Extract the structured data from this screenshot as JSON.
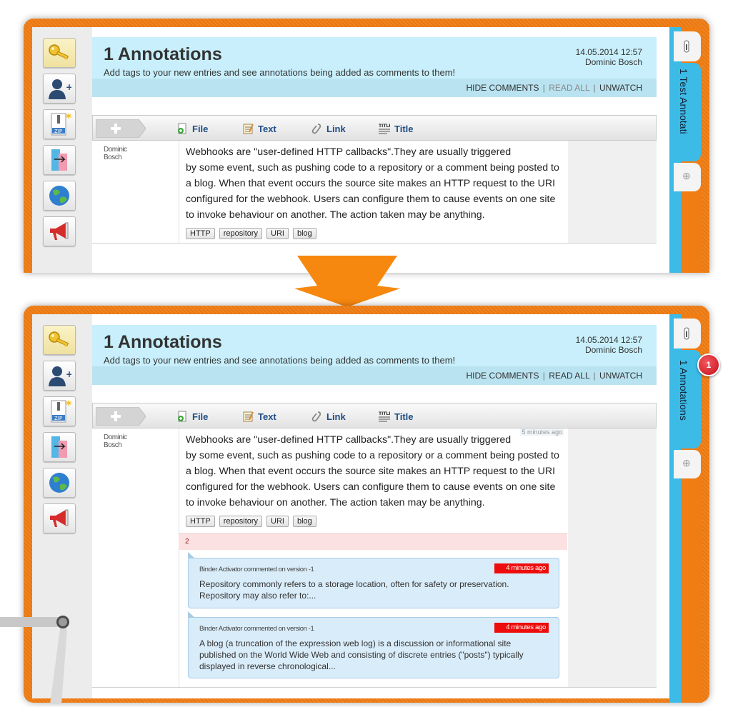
{
  "sidebar_tools": [
    "key-icon",
    "add-user-icon",
    "zip-icon",
    "export-icon",
    "globe-icon",
    "megaphone-icon"
  ],
  "before": {
    "tab_label": "1 Test Annotati",
    "header": {
      "title": "1 Annotations",
      "subtitle": "Add tags to your new entries and see annotations being added as comments to them!",
      "date": "14.05.2014 12:57",
      "user": "Dominic Bosch",
      "hide_comments": "HIDE COMMENTS",
      "read_all": "READ ALL",
      "unwatch": "UNWATCH",
      "separator": "|"
    },
    "toolbar": {
      "file": "File",
      "text": "Text",
      "link": "Link",
      "title": "Title"
    },
    "entry": {
      "author_first": "Dominic",
      "author_last": "Bosch",
      "lines": [
        "Webhooks are \"user-defined HTTP callbacks\".They are usually triggered",
        "by some event, such as pushing code to a repository or a comment being posted to",
        "a blog. When that event occurs the source site makes an HTTP request to the URI",
        "configured for the webhook. Users can configure them to cause events on one site",
        "to invoke behaviour on another. The action taken may be anything."
      ],
      "tags": [
        "HTTP",
        "repository",
        "URI",
        "blog"
      ]
    }
  },
  "after": {
    "tab_label": "1 Annotations",
    "badge_count": "1",
    "header": {
      "title": "1 Annotations",
      "subtitle": "Add tags to your new entries and see annotations being added as comments to them!",
      "date": "14.05.2014 12:57",
      "user": "Dominic Bosch",
      "hide_comments": "HIDE COMMENTS",
      "read_all": "READ ALL",
      "unwatch": "UNWATCH",
      "separator": "|"
    },
    "toolbar": {
      "file": "File",
      "text": "Text",
      "link": "Link",
      "title": "Title"
    },
    "entry": {
      "author_first": "Dominic",
      "author_last": "Bosch",
      "time_ago": "5 minutes ago",
      "lines": [
        "Webhooks are \"user-defined HTTP callbacks\".They are usually triggered",
        "by some event, such as pushing code to a repository or a comment being posted to",
        "a blog. When that event occurs the source site makes an HTTP request to the URI",
        "configured for the webhook. Users can configure them to cause events on one site",
        "to invoke behaviour on another. The action taken may be anything."
      ],
      "tags": [
        "HTTP",
        "repository",
        "URI",
        "blog"
      ],
      "comment_count": "2"
    },
    "comments": [
      {
        "meta": "Binder Activator commented on version -1",
        "time_ago": "4 minutes ago",
        "lines": [
          "Repository commonly refers to a storage location, often for safety or preservation.",
          "Repository may also refer to:..."
        ]
      },
      {
        "meta": "Binder Activator commented on version -1",
        "time_ago": "4 minutes ago",
        "lines": [
          "A blog (a truncation of the expression web log) is a discussion or informational site",
          "published on the World Wide Web and consisting of discrete entries (\"posts\") typically",
          "displayed in reverse chronological..."
        ]
      }
    ]
  },
  "colors": {
    "frame": "#f07d14",
    "tab_blue": "#3cbbe7",
    "header_bg": "#c8effb",
    "badge": "#d61c25",
    "time_badge": "#ee0d0d"
  }
}
